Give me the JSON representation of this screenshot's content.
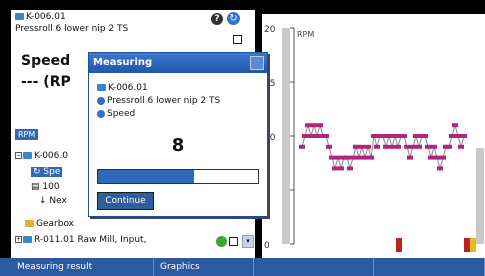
{
  "left": {
    "item_id": "K-006.01",
    "item_desc": "Pressroll 6 lower nip 2 TS",
    "title": "Speed",
    "subtitle": "--- (RP",
    "unit_tab": "RPM",
    "tree": [
      "K-006.0",
      "Spe",
      "100",
      "Nex",
      "Gearbox",
      "R-011.01 Raw Mill, Input,"
    ]
  },
  "dialog": {
    "title": "Measuring",
    "line1": "K-006.01",
    "line2": "Pressroll 6 lower nip 2 TS",
    "line3": "Speed",
    "count": "8",
    "progress": 0.6,
    "button": "Continue"
  },
  "chart_data": {
    "type": "line",
    "ylabel": "RPM",
    "ylim": [
      0,
      20
    ],
    "yticks": [
      "20",
      "15",
      "10",
      "5",
      "0"
    ],
    "x": [
      1,
      2,
      3,
      4,
      5,
      6,
      7,
      8,
      9,
      10,
      11,
      12,
      13,
      14,
      15,
      16,
      17,
      18,
      19,
      20,
      21,
      22,
      23,
      24,
      25,
      26,
      27,
      28,
      29,
      30,
      31,
      32,
      33,
      34,
      35,
      36,
      37,
      38,
      39,
      40,
      41,
      42,
      43,
      44,
      45,
      46,
      47,
      48,
      49,
      50,
      51,
      52,
      53,
      54,
      55
    ],
    "values": [
      9,
      10,
      11,
      10,
      11,
      10,
      11,
      10,
      10,
      9,
      8,
      7,
      8,
      7,
      8,
      8,
      7,
      8,
      9,
      8,
      9,
      8,
      9,
      8,
      10,
      9,
      10,
      10,
      9,
      10,
      9,
      10,
      9,
      10,
      10,
      9,
      8,
      9,
      10,
      9,
      10,
      10,
      9,
      8,
      9,
      8,
      7,
      8,
      9,
      9,
      10,
      11,
      10,
      9,
      10
    ],
    "colors": {
      "line": "#888888",
      "marker": "#b0267e",
      "bar_left": "#c9c9c9"
    }
  },
  "bottom_tabs": [
    "Measuring result",
    "Graphics",
    "",
    ""
  ]
}
